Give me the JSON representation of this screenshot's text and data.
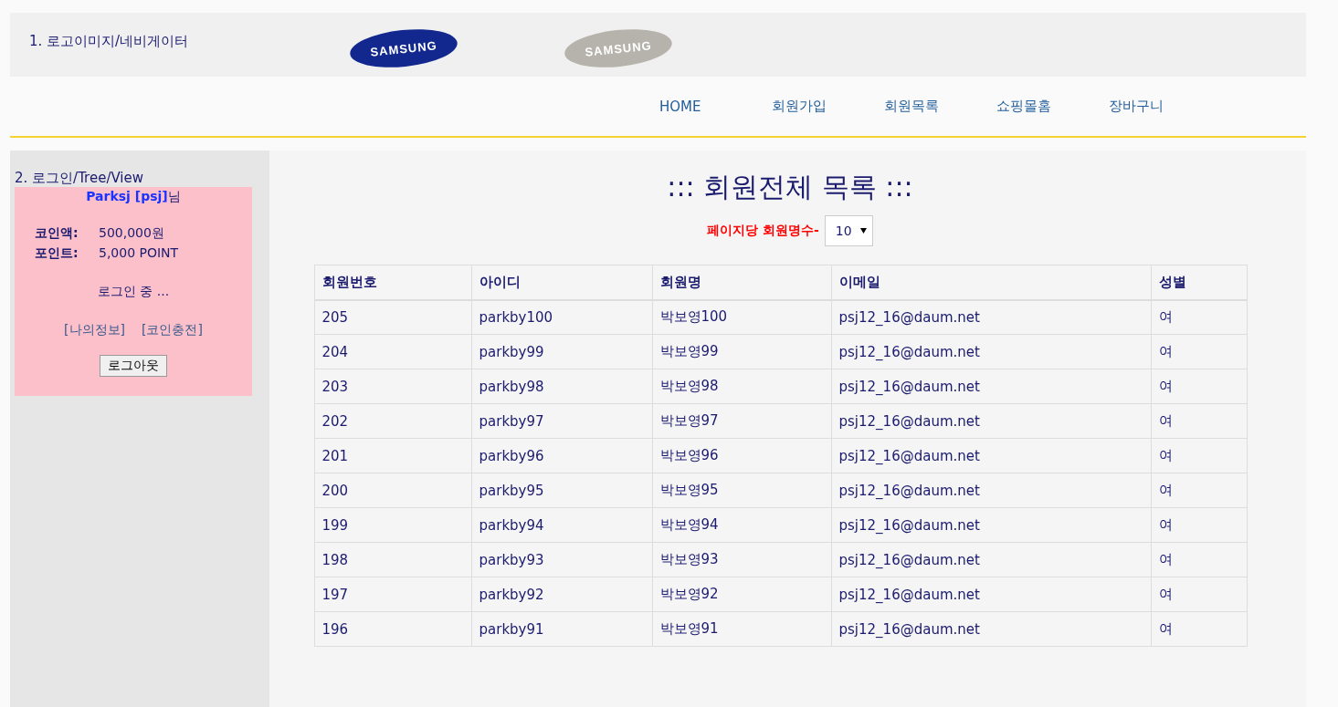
{
  "header": {
    "title": "1. 로고이미지/네비게이터",
    "logos": [
      {
        "text": "SAMSUNG",
        "kind": "active"
      },
      {
        "text": "SAMSUNG",
        "kind": "inactive"
      }
    ]
  },
  "nav": [
    "HOME",
    "회원가입",
    "회원목록",
    "쇼핑몰홈",
    "장바구니"
  ],
  "sidebar": {
    "title": "2. 로그인/Tree/View",
    "user": "**Parksj [psj]**님",
    "info": [
      {
        "label": "코인액:",
        "value": "500,000원"
      },
      {
        "label": "포인트:",
        "value": "5,000 POINT"
      }
    ],
    "status": "로그인 중 ...",
    "links": [
      "[나의정보]",
      "[코인충전]"
    ],
    "logout_button": "로그아웃"
  },
  "main": {
    "title": "::: 회원전체 목록 :::",
    "per_page_label": "페이지당 회원명수-",
    "per_page": {
      "value": "10"
    },
    "table": {
      "columns": [
        "회원번호",
        "아이디",
        "회원명",
        "이메일",
        "성별"
      ],
      "rows": [
        [
          "205",
          "parkby100",
          "박보영100",
          "psj12_16@daum.net",
          "여"
        ],
        [
          "204",
          "parkby99",
          "박보영99",
          "psj12_16@daum.net",
          "여"
        ],
        [
          "203",
          "parkby98",
          "박보영98",
          "psj12_16@daum.net",
          "여"
        ],
        [
          "202",
          "parkby97",
          "박보영97",
          "psj12_16@daum.net",
          "여"
        ],
        [
          "201",
          "parkby96",
          "박보영96",
          "psj12_16@daum.net",
          "여"
        ],
        [
          "200",
          "parkby95",
          "박보영95",
          "psj12_16@daum.net",
          "여"
        ],
        [
          "199",
          "parkby94",
          "박보영94",
          "psj12_16@daum.net",
          "여"
        ],
        [
          "198",
          "parkby93",
          "박보영93",
          "psj12_16@daum.net",
          "여"
        ],
        [
          "197",
          "parkby92",
          "박보영92",
          "psj12_16@daum.net",
          "여"
        ],
        [
          "196",
          "parkby91",
          "박보영91",
          "psj12_16@daum.net",
          "여"
        ]
      ]
    }
  }
}
